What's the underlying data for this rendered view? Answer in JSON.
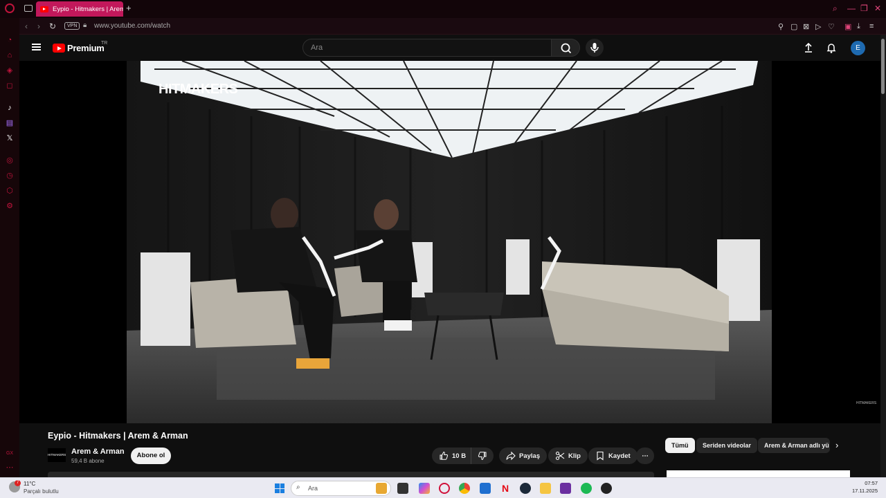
{
  "browser": {
    "tab_title": "Eypio - Hitmakers | Arem",
    "new_tab": "+",
    "vpn_label": "VPN",
    "url": "www.youtube.com/watch"
  },
  "youtube": {
    "brand": "Premium",
    "brand_region": "TR",
    "search_placeholder": "Ara",
    "avatar_letter": "E"
  },
  "video": {
    "overlay_title": "HITMAKERS",
    "watermark": "HITMAKERS",
    "title": "Eypio - Hitmakers | Arem & Arman"
  },
  "channel": {
    "avatar_text": "HITMAKERS",
    "name": "Arem & Arman",
    "subscribers": "59,4 B abone",
    "subscribe_label": "Abone ol"
  },
  "actions": {
    "likes": "10 B",
    "share": "Paylaş",
    "clip": "Klip",
    "save": "Kaydet",
    "more": "⋯"
  },
  "chips": [
    "Tümü",
    "Seriden videolar",
    "Arem & Arman adlı yü"
  ],
  "taskbar": {
    "temperature": "11°C",
    "condition": "Parçalı bulutlu",
    "weather_badge": "7",
    "search_placeholder": "Ara",
    "time": "07:57",
    "date": "17.11.2025"
  },
  "colors": {
    "accent": "#c0143c",
    "youtube_red": "#ff0000",
    "background": "#0f0f0f"
  }
}
